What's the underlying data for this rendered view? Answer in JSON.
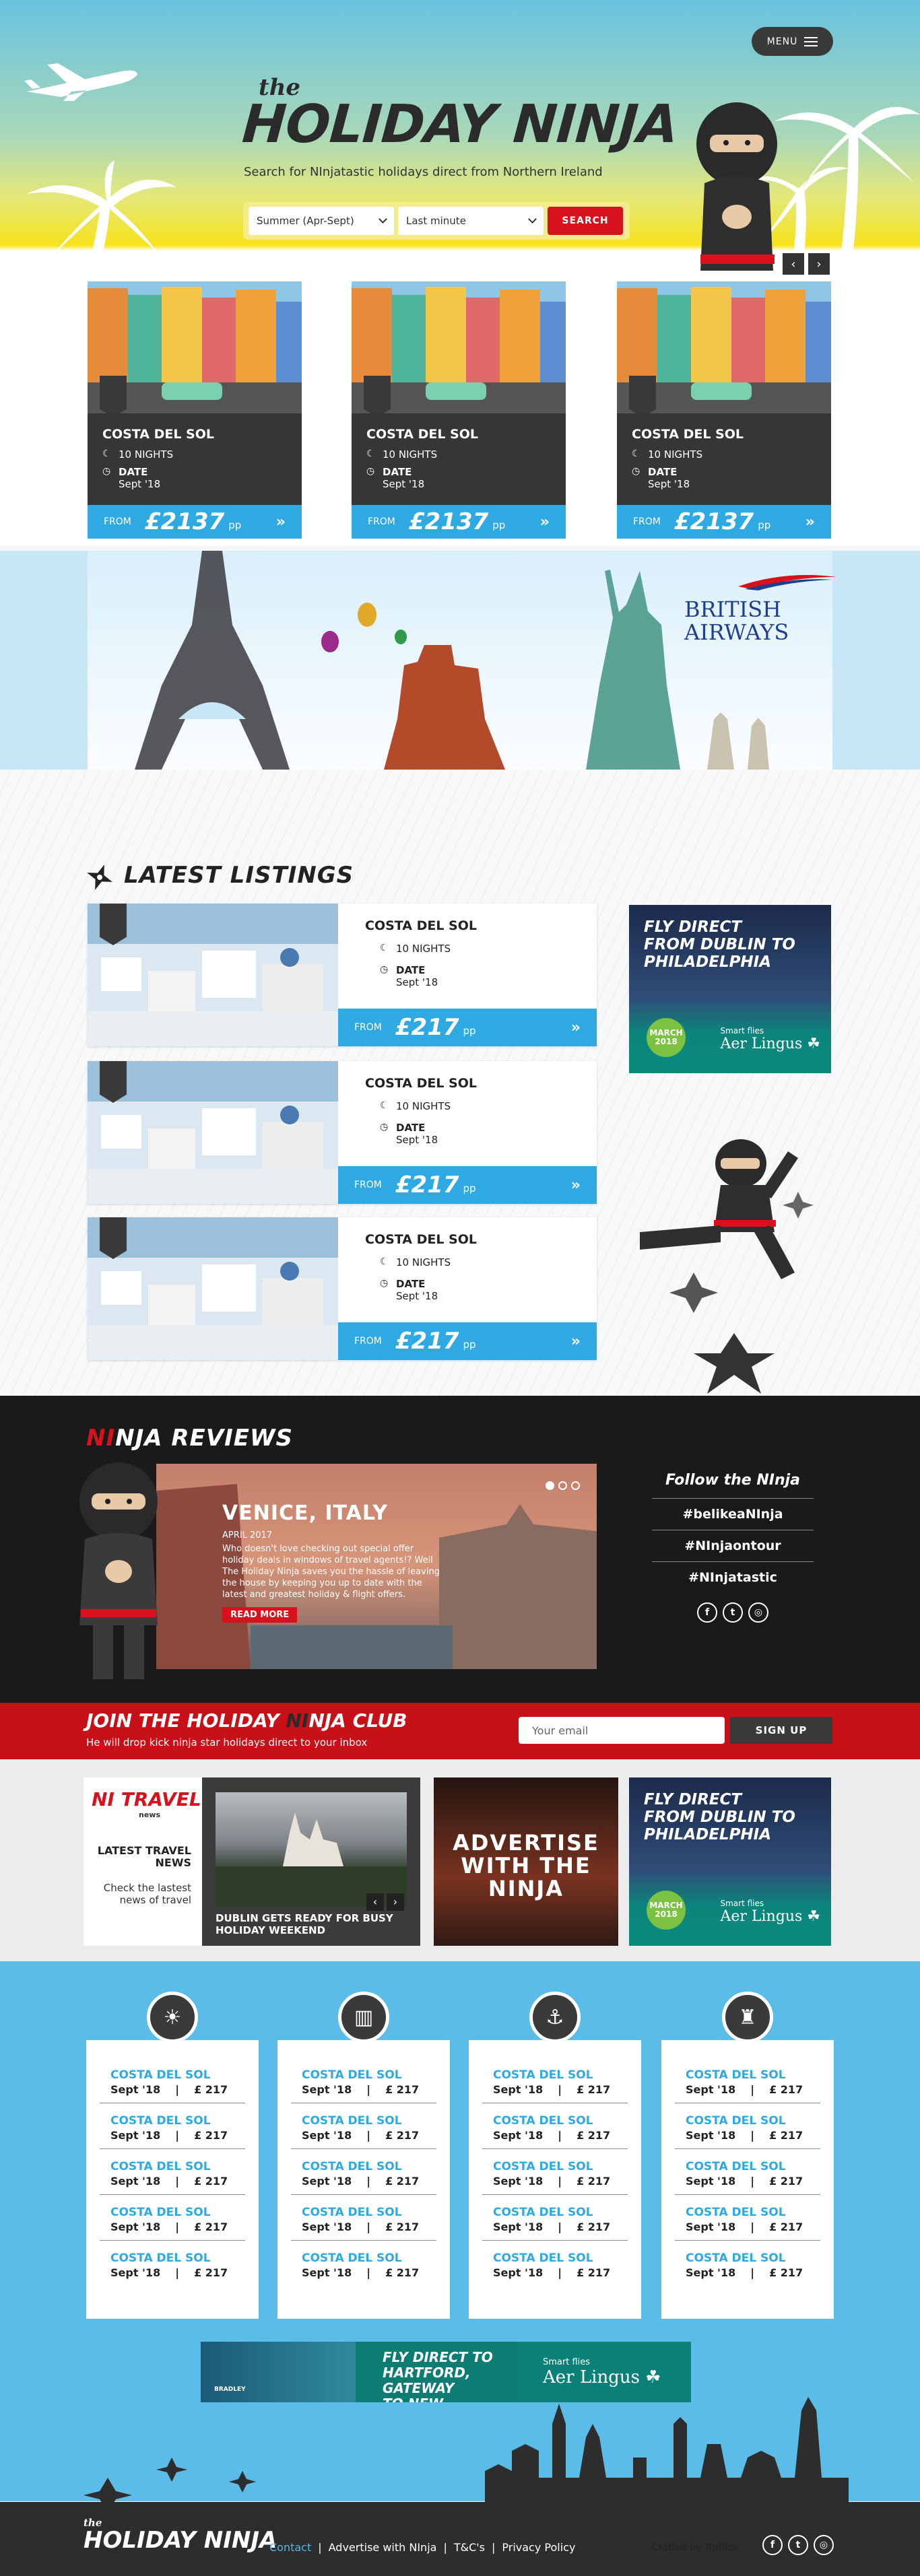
{
  "header": {
    "menu_label": "MENU",
    "logo_the": "the",
    "logo_holiday": "HOLIDAY ",
    "logo_ninja": "NINJA",
    "tagline": "Search for NInjatastic holidays direct from Northern Ireland",
    "season_select": "Summer (Apr-Sept)",
    "when_select": "Last minute",
    "search_label": "SEARCH",
    "prev": "‹",
    "next": "›"
  },
  "hero_cards": [
    {
      "title": "COSTA DEL SOL",
      "nights": "10 NIGHTS",
      "date_label": "DATE",
      "date": "Sept '18",
      "from": "FROM",
      "price": "£2137",
      "pp": "pp",
      "go": "»"
    },
    {
      "title": "COSTA DEL SOL",
      "nights": "10 NIGHTS",
      "date_label": "DATE",
      "date": "Sept '18",
      "from": "FROM",
      "price": "£2137",
      "pp": "pp",
      "go": "»"
    },
    {
      "title": "COSTA DEL SOL",
      "nights": "10 NIGHTS",
      "date_label": "DATE",
      "date": "Sept '18",
      "from": "FROM",
      "price": "£2137",
      "pp": "pp",
      "go": "»"
    }
  ],
  "ba_banner": {
    "line1": "BRITISH",
    "line2": "AIRWAYS"
  },
  "leaderboard": {
    "line1": "FLY DIRECT TO",
    "line2": "HARTFORD, GATEWAY",
    "line3": "TO NEW ENGLAND",
    "smart": "Smart flies",
    "brand": "Aer Lingus ☘",
    "badge": "BRADLEY"
  },
  "latest": {
    "title": "LATEST LISTINGS",
    "items": [
      {
        "title": "COSTA DEL SOL",
        "nights": "10 NIGHTS",
        "date_label": "DATE",
        "date": "Sept '18",
        "from": "FROM",
        "price": "£217",
        "pp": "pp",
        "go": "»"
      },
      {
        "title": "COSTA DEL SOL",
        "nights": "10 NIGHTS",
        "date_label": "DATE",
        "date": "Sept '18",
        "from": "FROM",
        "price": "£217",
        "pp": "pp",
        "go": "»"
      },
      {
        "title": "COSTA DEL SOL",
        "nights": "10 NIGHTS",
        "date_label": "DATE",
        "date": "Sept '18",
        "from": "FROM",
        "price": "£217",
        "pp": "pp",
        "go": "»"
      }
    ]
  },
  "mpu": {
    "line1": "FLY DIRECT",
    "line2": "FROM DUBLIN TO",
    "line3": "PHILADELPHIA",
    "badge1": "MARCH",
    "badge2": "2018",
    "smart": "Smart flies",
    "brand": "Aer Lingus ☘"
  },
  "reviews": {
    "title_a": "NI",
    "title_b": "NJA REVIEWS",
    "place": "VENICE, ITALY",
    "date": "APRIL 2017",
    "body": "Who doesn't love checking out special offer holiday deals in windows of travel agents!? Well The Holiday Ninja saves you the hassle of leaving the house by keeping you up to date with the latest and greatest holiday & flight offers.",
    "read_more": "READ MORE"
  },
  "follow": {
    "title": "Follow the NInja",
    "tags": [
      "#belikeaNInja",
      "#NInjaontour",
      "#NInjatastic"
    ],
    "socials": [
      "f",
      "t",
      "◎"
    ]
  },
  "club": {
    "title_a": "JOIN THE HOLIDAY ",
    "title_b": "NI",
    "title_c": "NJA CLUB",
    "subtitle": "He will drop kick ninja star holidays direct to your inbox",
    "email_placeholder": "Your email",
    "signup": "SIGN UP"
  },
  "news": {
    "logo": "NI TRAVEL",
    "logo_sub": "news",
    "latest": "LATEST TRAVEL NEWS",
    "check": "Check the lastest news of travel",
    "caption": "DUBLIN GETS READY FOR BUSY HOLIDAY WEEKEND",
    "prev": "‹",
    "next": "›"
  },
  "advertise": {
    "line1": "ADVERTISE",
    "line2": "WITH THE",
    "line3": "NINJA"
  },
  "deals": {
    "icons": [
      "☀",
      "▥",
      "⚓",
      "♜"
    ],
    "columns": [
      [
        {
          "name": "COSTA DEL SOL",
          "date": "Sept '18",
          "price": "£ 217"
        },
        {
          "name": "COSTA DEL SOL",
          "date": "Sept '18",
          "price": "£ 217"
        },
        {
          "name": "COSTA DEL SOL",
          "date": "Sept '18",
          "price": "£ 217"
        },
        {
          "name": "COSTA DEL SOL",
          "date": "Sept '18",
          "price": "£ 217"
        },
        {
          "name": "COSTA DEL SOL",
          "date": "Sept '18",
          "price": "£ 217"
        }
      ],
      [
        {
          "name": "COSTA DEL SOL",
          "date": "Sept '18",
          "price": "£ 217"
        },
        {
          "name": "COSTA DEL SOL",
          "date": "Sept '18",
          "price": "£ 217"
        },
        {
          "name": "COSTA DEL SOL",
          "date": "Sept '18",
          "price": "£ 217"
        },
        {
          "name": "COSTA DEL SOL",
          "date": "Sept '18",
          "price": "£ 217"
        },
        {
          "name": "COSTA DEL SOL",
          "date": "Sept '18",
          "price": "£ 217"
        }
      ],
      [
        {
          "name": "COSTA DEL SOL",
          "date": "Sept '18",
          "price": "£ 217"
        },
        {
          "name": "COSTA DEL SOL",
          "date": "Sept '18",
          "price": "£ 217"
        },
        {
          "name": "COSTA DEL SOL",
          "date": "Sept '18",
          "price": "£ 217"
        },
        {
          "name": "COSTA DEL SOL",
          "date": "Sept '18",
          "price": "£ 217"
        },
        {
          "name": "COSTA DEL SOL",
          "date": "Sept '18",
          "price": "£ 217"
        }
      ],
      [
        {
          "name": "COSTA DEL SOL",
          "date": "Sept '18",
          "price": "£ 217"
        },
        {
          "name": "COSTA DEL SOL",
          "date": "Sept '18",
          "price": "£ 217"
        },
        {
          "name": "COSTA DEL SOL",
          "date": "Sept '18",
          "price": "£ 217"
        },
        {
          "name": "COSTA DEL SOL",
          "date": "Sept '18",
          "price": "£ 217"
        },
        {
          "name": "COSTA DEL SOL",
          "date": "Sept '18",
          "price": "£ 217"
        }
      ]
    ]
  },
  "footer": {
    "logo_the": "the",
    "logo": "HOLIDAY NINJA",
    "nav": [
      "Contact",
      "Advertise with NInja",
      "T&C's",
      "Privacy Policy"
    ],
    "sep": "|",
    "crafted": "Crafted by Traffick",
    "socials": [
      "f",
      "t",
      "◎"
    ]
  },
  "colors": {
    "accent_blue": "#2ea9e1",
    "accent_red": "#d8121c",
    "dark": "#363636",
    "sky": "#5bbce8",
    "aer_green": "#0d7d73"
  }
}
